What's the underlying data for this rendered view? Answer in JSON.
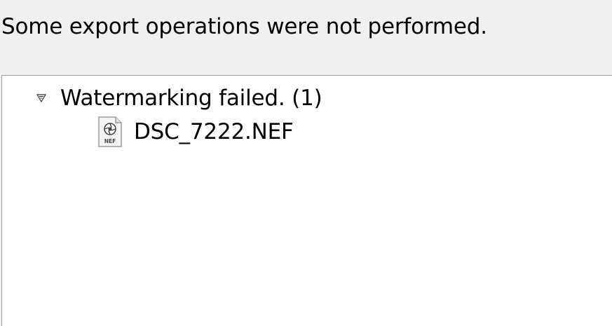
{
  "dialog": {
    "message": "Some export operations were not performed."
  },
  "tree": {
    "group": {
      "label": "Watermarking failed. (1)",
      "expander_icon": "triangle-down-icon",
      "expanded": true
    },
    "files": [
      {
        "name": "DSC_7222.NEF",
        "icon": "nef-file-icon",
        "icon_badge": "NEF"
      }
    ]
  }
}
